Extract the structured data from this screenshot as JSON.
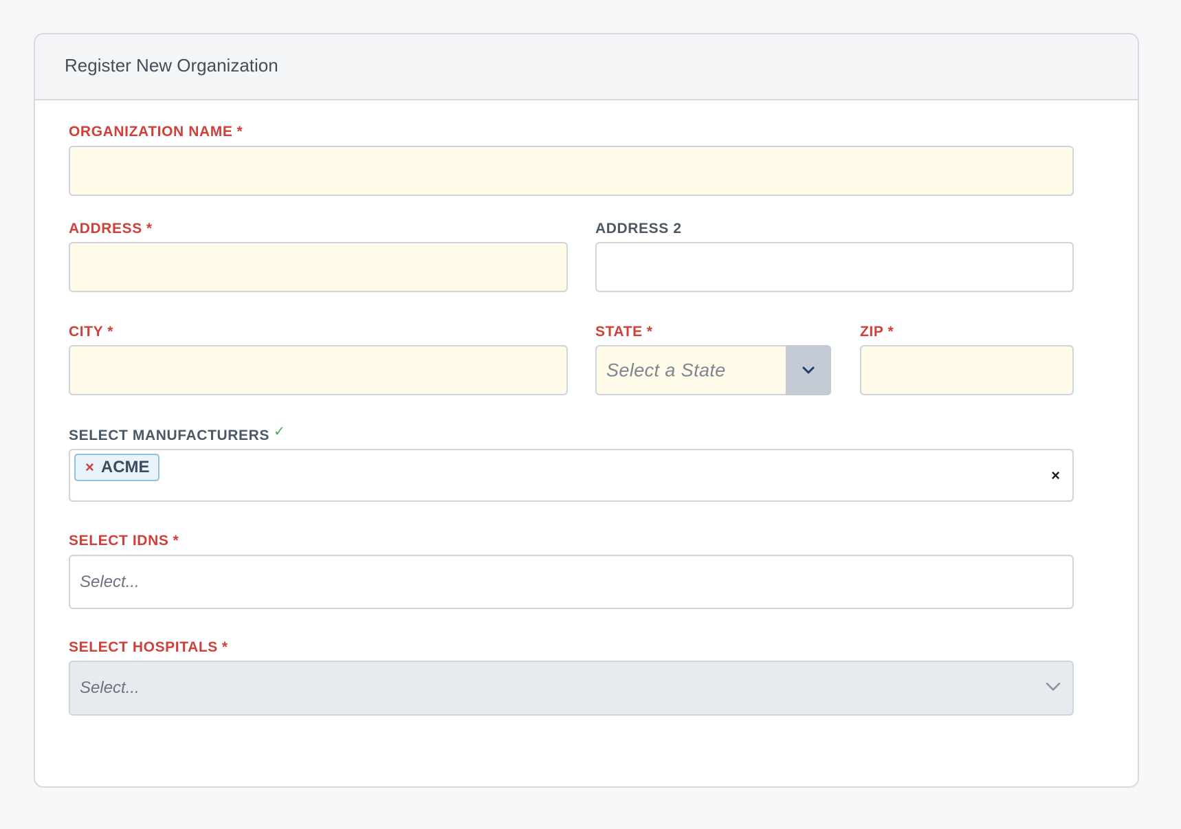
{
  "form": {
    "title": "Register New Organization",
    "required_mark": "*",
    "valid_mark": "✓",
    "fields": {
      "organization_name": {
        "label": "ORGANIZATION NAME",
        "value": ""
      },
      "address": {
        "label": "ADDRESS",
        "value": ""
      },
      "address2": {
        "label": "ADDRESS 2",
        "value": ""
      },
      "city": {
        "label": "CITY",
        "value": ""
      },
      "state": {
        "label": "STATE",
        "placeholder": "Select a State"
      },
      "zip": {
        "label": "ZIP",
        "value": ""
      },
      "manufacturers": {
        "label": "SELECT MANUFACTURERS",
        "selected": [
          "ACME"
        ],
        "tag_remove_glyph": "×",
        "clear_glyph": "×"
      },
      "idns": {
        "label": "SELECT IDNS",
        "placeholder": "Select..."
      },
      "hospitals": {
        "label": "SELECT HOSPITALS",
        "placeholder": "Select...",
        "disabled": true
      }
    }
  },
  "colors": {
    "required_label": "#d0403a",
    "optional_label": "#4b5866",
    "required_input_bg": "#fffbe8",
    "disabled_input_bg": "#e7ebef",
    "tag_bg": "#e8f3fb",
    "tag_border": "#8fc2e6",
    "valid_check": "#3fae4e"
  },
  "icons": {
    "state_dropdown": "chevron-down-icon",
    "hospitals_dropdown": "chevron-down-icon",
    "tag_remove": "close-icon",
    "clear_selection": "close-icon"
  }
}
